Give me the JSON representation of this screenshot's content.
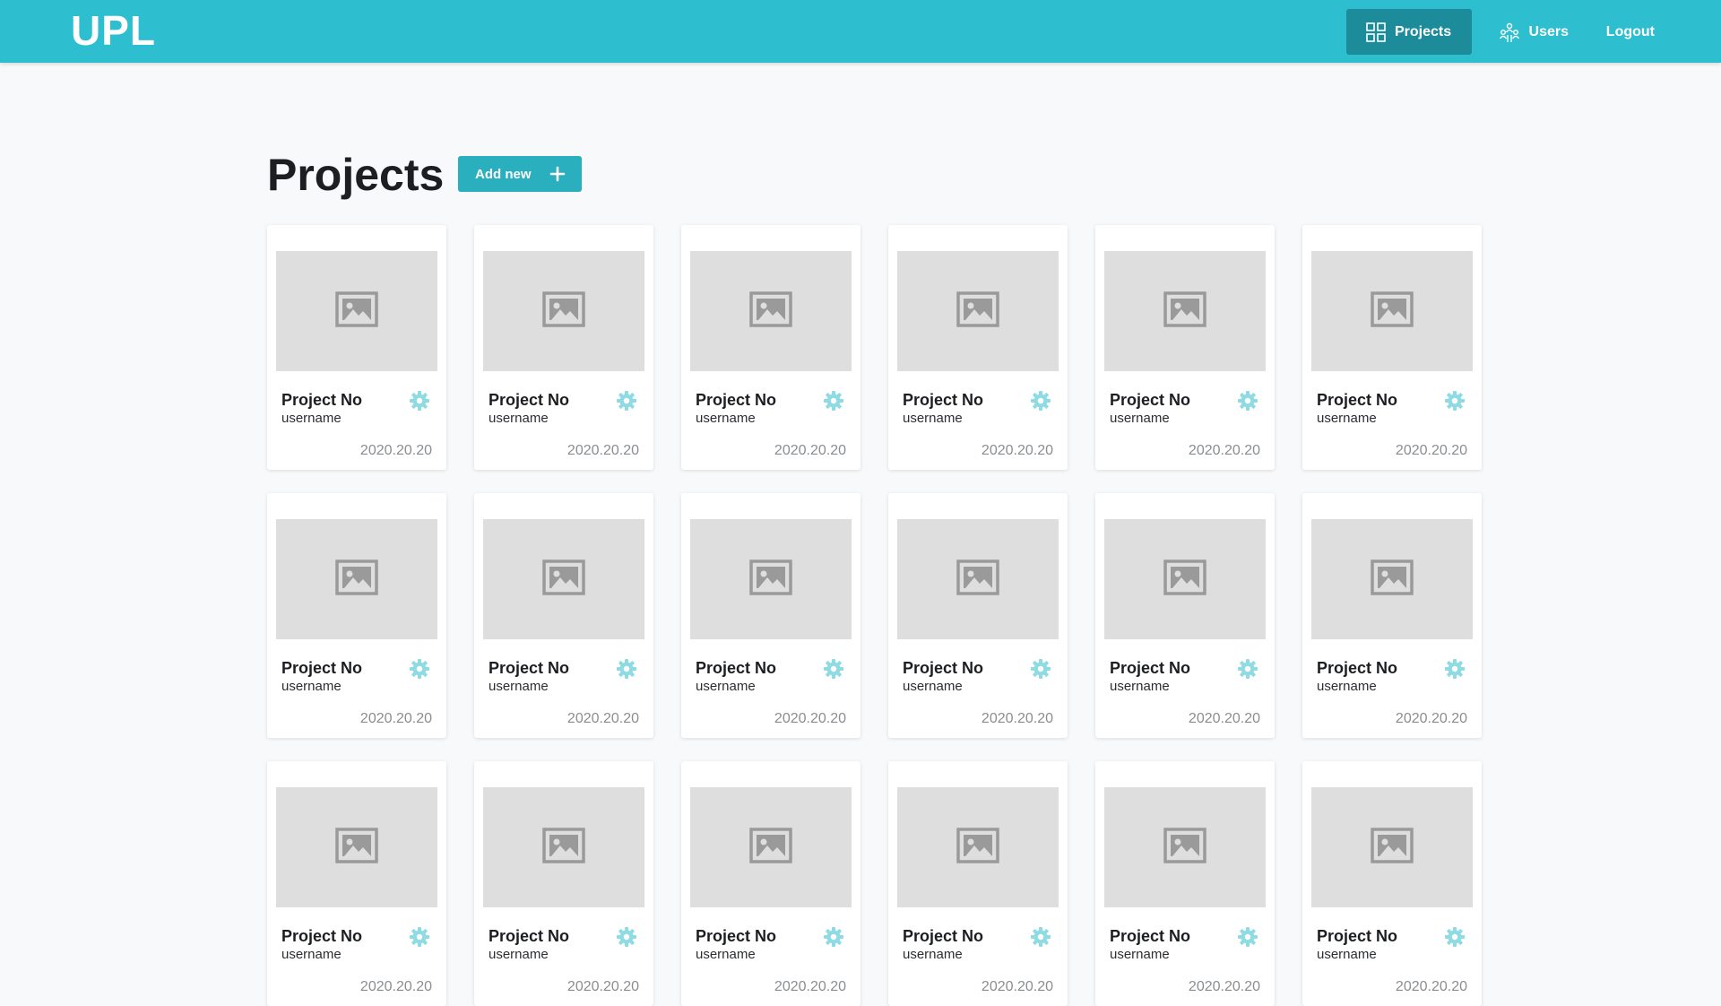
{
  "app": {
    "logo": "UPL"
  },
  "nav": {
    "items": [
      {
        "label": "Projects",
        "icon": "grid-icon",
        "active": true
      },
      {
        "label": "Users",
        "icon": "users-icon",
        "active": false
      },
      {
        "label": "Logout",
        "icon": "",
        "active": false
      }
    ]
  },
  "page": {
    "title": "Projects",
    "add_button_label": "Add new"
  },
  "projects": [
    {
      "title": "Project No",
      "user": "username",
      "date": "2020.20.20"
    },
    {
      "title": "Project No",
      "user": "username",
      "date": "2020.20.20"
    },
    {
      "title": "Project No",
      "user": "username",
      "date": "2020.20.20"
    },
    {
      "title": "Project No",
      "user": "username",
      "date": "2020.20.20"
    },
    {
      "title": "Project No",
      "user": "username",
      "date": "2020.20.20"
    },
    {
      "title": "Project No",
      "user": "username",
      "date": "2020.20.20"
    },
    {
      "title": "Project No",
      "user": "username",
      "date": "2020.20.20"
    },
    {
      "title": "Project No",
      "user": "username",
      "date": "2020.20.20"
    },
    {
      "title": "Project No",
      "user": "username",
      "date": "2020.20.20"
    },
    {
      "title": "Project No",
      "user": "username",
      "date": "2020.20.20"
    },
    {
      "title": "Project No",
      "user": "username",
      "date": "2020.20.20"
    },
    {
      "title": "Project No",
      "user": "username",
      "date": "2020.20.20"
    },
    {
      "title": "Project No",
      "user": "username",
      "date": "2020.20.20"
    },
    {
      "title": "Project No",
      "user": "username",
      "date": "2020.20.20"
    },
    {
      "title": "Project No",
      "user": "username",
      "date": "2020.20.20"
    },
    {
      "title": "Project No",
      "user": "username",
      "date": "2020.20.20"
    },
    {
      "title": "Project No",
      "user": "username",
      "date": "2020.20.20"
    },
    {
      "title": "Project No",
      "user": "username",
      "date": "2020.20.20"
    }
  ],
  "colors": {
    "header": "#2dbecf",
    "nav_active": "#1c8c9b",
    "button": "#2aafbf",
    "gear": "#8fdbe4",
    "placeholder": "#dedede"
  }
}
